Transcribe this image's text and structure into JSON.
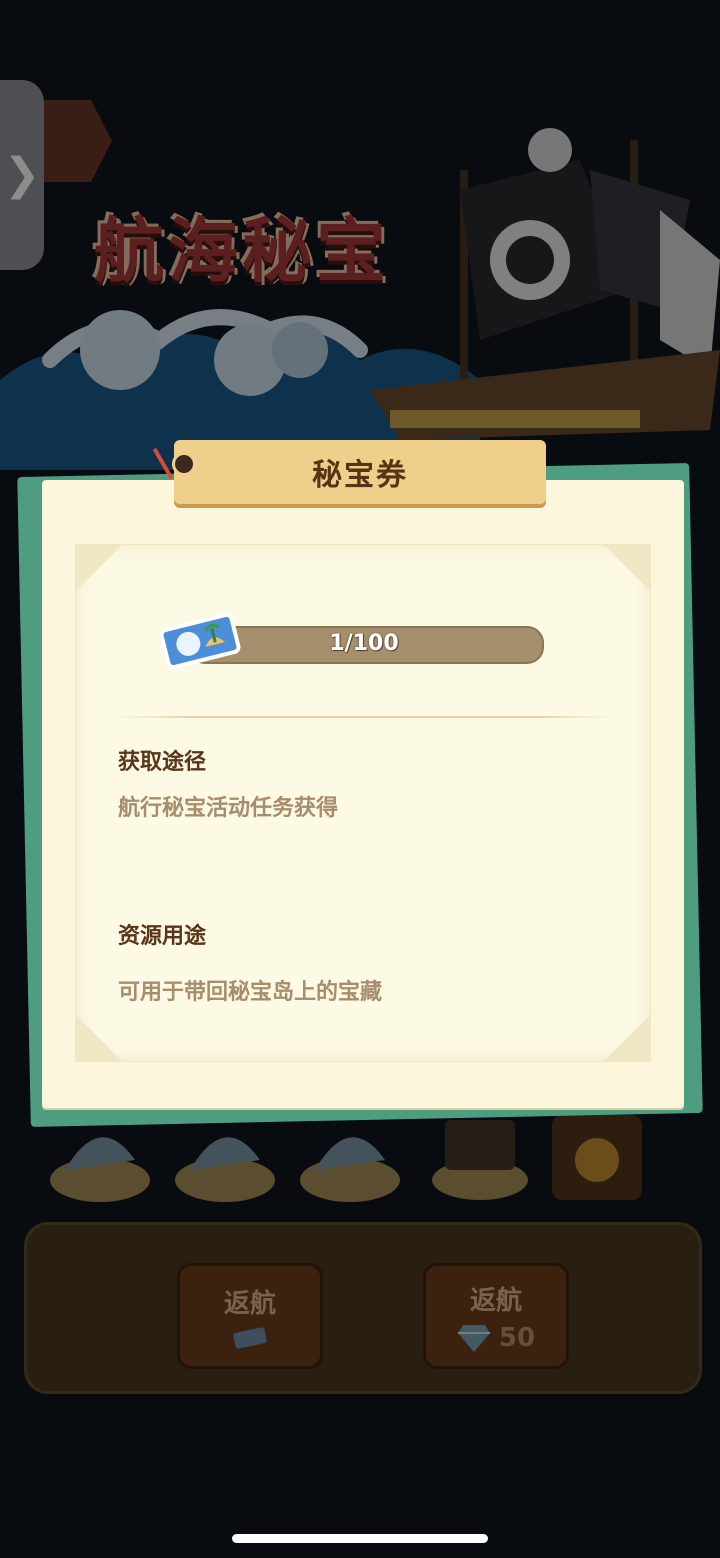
{
  "game": {
    "title": "航海秘宝"
  },
  "popup": {
    "title": "秘宝券",
    "progress": {
      "text": "1/100",
      "current": 1,
      "max": 100,
      "fraction": 0.01
    },
    "sections": [
      {
        "heading": "获取途径",
        "text": "航行秘宝活动任务获得"
      },
      {
        "heading": "资源用途",
        "text": "可用于带回秘宝岛上的宝藏"
      }
    ]
  },
  "bottom": {
    "buttons": [
      {
        "label": "返航",
        "cost_icon": "ticket-icon"
      },
      {
        "label": "返航",
        "cost_icon": "diamond-icon",
        "cost": "50"
      }
    ]
  },
  "side_tab": {
    "glyph": "❯"
  },
  "colors": {
    "card": "#fbf6dc",
    "ribbon": "#f0cf8a",
    "card_edge": "#4f9d80",
    "title_text": "#5b3519",
    "body_text": "#a88d6d"
  }
}
